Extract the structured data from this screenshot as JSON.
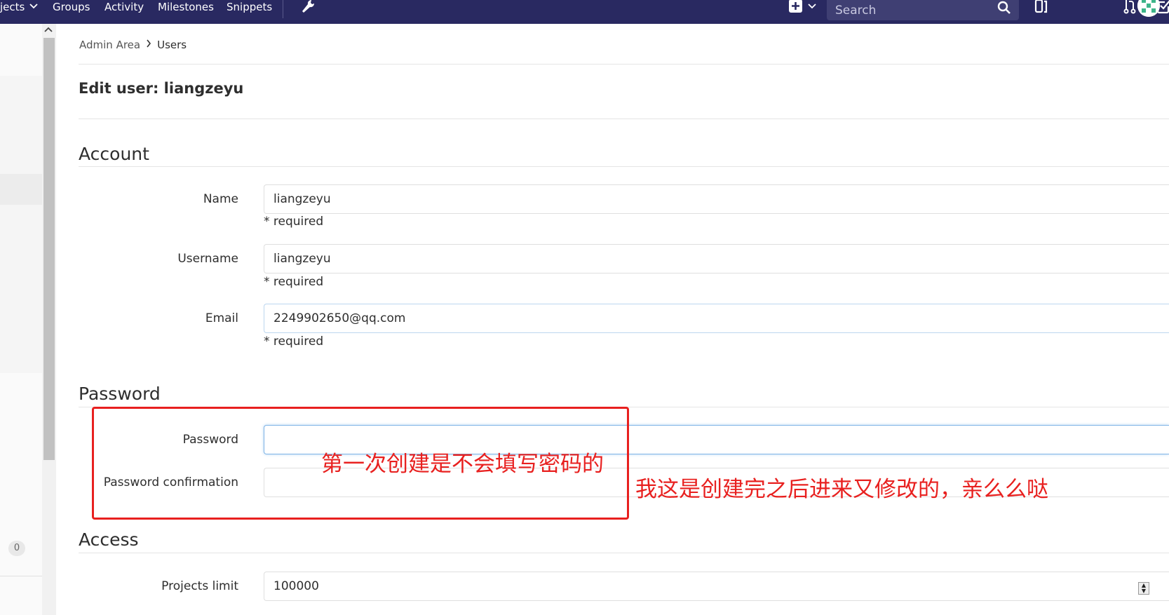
{
  "navbar": {
    "projects_label": "jects",
    "groups_label": "Groups",
    "activity_label": "Activity",
    "milestones_label": "Milestones",
    "snippets_label": "Snippets",
    "search_placeholder": "Search",
    "background_color": "#292961"
  },
  "sidebar": {
    "badge_count": "0"
  },
  "breadcrumb": {
    "admin_area": "Admin Area",
    "current": "Users"
  },
  "page_title": "Edit user: liangzeyu",
  "sections": {
    "account": {
      "title": "Account",
      "name_label": "Name",
      "name_value": "liangzeyu",
      "username_label": "Username",
      "username_value": "liangzeyu",
      "email_label": "Email",
      "email_value": "2249902650@qq.com",
      "required_text": "* required"
    },
    "password": {
      "title": "Password",
      "password_label": "Password",
      "password_value": "",
      "confirmation_label": "Password confirmation",
      "confirmation_value": ""
    },
    "access": {
      "title": "Access",
      "projects_limit_label": "Projects limit",
      "projects_limit_value": "100000"
    }
  },
  "annotations": {
    "note_1": "第一次创建是不会填写密码的",
    "note_2": "我这是创建完之后进来又修改的，亲么么哒",
    "color": "#e8201f"
  }
}
